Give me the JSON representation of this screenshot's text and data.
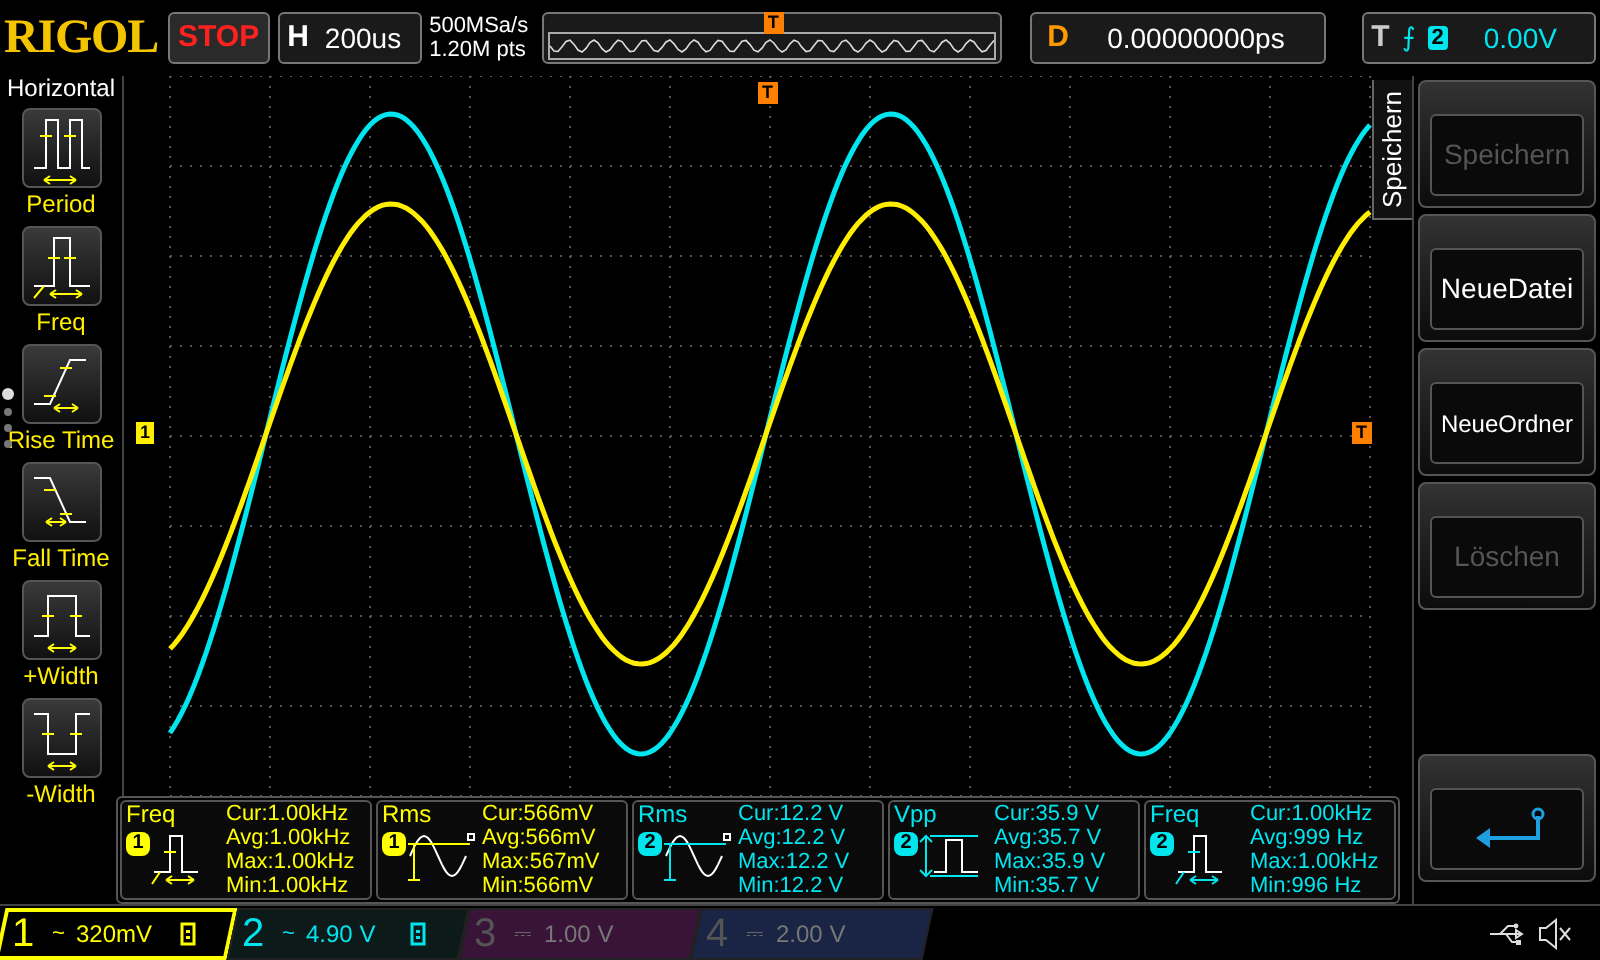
{
  "top_bar": {
    "brand": "RIGOL",
    "run_state": "STOP",
    "horizontal": {
      "label": "H",
      "timebase": "200us"
    },
    "sample_rate": "500MSa/s",
    "memory_depth": "1.20M pts",
    "trigger_position": "T",
    "delay": {
      "label": "D",
      "value": "0.00000000ps"
    },
    "trigger": {
      "label": "T",
      "slope": "⨍",
      "source": "2",
      "level": "0.00V"
    }
  },
  "left_menu": {
    "title": "Horizontal",
    "items": [
      {
        "label": "Period",
        "kind": "period"
      },
      {
        "label": "Freq",
        "kind": "freq"
      },
      {
        "label": "Rise Time",
        "kind": "rise"
      },
      {
        "label": "Fall Time",
        "kind": "fall"
      },
      {
        "label": "+Width",
        "kind": "pwidth"
      },
      {
        "label": "-Width",
        "kind": "nwidth"
      }
    ],
    "pages": [
      {
        "selected": true
      },
      {
        "selected": false
      },
      {
        "selected": false
      },
      {
        "selected": false
      }
    ]
  },
  "plot": {
    "channel_marker": "1",
    "trigger_marker": "T",
    "trigger_position_marker": "T"
  },
  "measurements": [
    {
      "name": "Freq",
      "channel": "1",
      "color": "#ffff00",
      "kind": "freq",
      "cur": "Cur:1.00kHz",
      "avg": "Avg:1.00kHz",
      "max": "Max:1.00kHz",
      "min": "Min:1.00kHz"
    },
    {
      "name": "Rms",
      "channel": "1",
      "color": "#ffff00",
      "kind": "rms",
      "cur": "Cur:566mV",
      "avg": "Avg:566mV",
      "max": "Max:567mV",
      "min": "Min:566mV"
    },
    {
      "name": "Rms",
      "channel": "2",
      "color": "#00e5ee",
      "kind": "rms",
      "cur": "Cur:12.2 V",
      "avg": "Avg:12.2 V",
      "max": "Max:12.2 V",
      "min": "Min:12.2 V"
    },
    {
      "name": "Vpp",
      "channel": "2",
      "color": "#00e5ee",
      "kind": "vpp",
      "cur": "Cur:35.9 V",
      "avg": "Avg:35.7 V",
      "max": "Max:35.9 V",
      "min": "Min:35.7 V"
    },
    {
      "name": "Freq",
      "channel": "2",
      "color": "#00e5ee",
      "kind": "freq",
      "cur": "Cur:1.00kHz",
      "avg": "Avg:999 Hz",
      "max": "Max:1.00kHz",
      "min": "Min:996 Hz"
    }
  ],
  "right_menu": {
    "tab": "Speichern",
    "buttons": [
      {
        "kind": "text",
        "label": "Speichern",
        "disabled": true
      },
      {
        "kind": "text",
        "label": "NeueDatei",
        "disabled": false
      },
      {
        "kind": "text",
        "label": "NeueOrdner",
        "disabled": false
      },
      {
        "kind": "text",
        "label": "Löschen",
        "disabled": true
      },
      {
        "kind": "back"
      }
    ]
  },
  "channels": [
    {
      "number": "1",
      "coupling": "~",
      "scale": "320mV",
      "on": true,
      "selected": true,
      "color": "#ffff00"
    },
    {
      "number": "2",
      "coupling": "~",
      "scale": "4.90 V",
      "on": true,
      "selected": false,
      "color": "#00e5ee"
    },
    {
      "number": "3",
      "coupling": "⎓",
      "scale": "1.00 V",
      "on": false,
      "selected": false,
      "color": "#3a1438"
    },
    {
      "number": "4",
      "coupling": "⎓",
      "scale": "2.00 V",
      "on": false,
      "selected": false,
      "color": "#1a2444"
    }
  ]
}
